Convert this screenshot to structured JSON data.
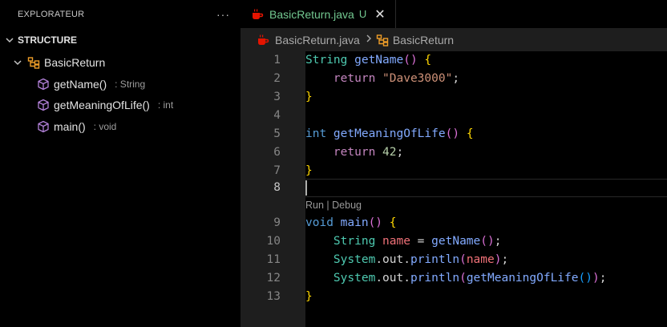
{
  "sidebar": {
    "title": "EXPLORATEUR",
    "more_label": "···",
    "section_label": "STRUCTURE",
    "class_name": "BasicReturn",
    "members": [
      {
        "name": "getName()",
        "detail": ": String",
        "icon": "method-cube-icon"
      },
      {
        "name": "getMeaningOfLife()",
        "detail": ": int",
        "icon": "method-cube-icon"
      },
      {
        "name": "main()",
        "detail": ": void",
        "icon": "method-cube-icon"
      }
    ]
  },
  "tab": {
    "file_name": "BasicReturn.java",
    "status": "U",
    "close_label": "✕",
    "icon": "java-file-icon"
  },
  "breadcrumbs": {
    "file": "BasicReturn.java",
    "symbol": "BasicReturn"
  },
  "codelens": {
    "run": "Run",
    "sep": " | ",
    "debug": "Debug"
  },
  "editor": {
    "line_numbers": [
      "1",
      "2",
      "3",
      "4",
      "5",
      "6",
      "7",
      "8",
      "9",
      "10",
      "11",
      "12",
      "13"
    ],
    "active_line": "8",
    "lines": [
      [
        [
          "String ",
          "t-type"
        ],
        [
          "getName",
          "t-fn2"
        ],
        [
          "()",
          "t-br2"
        ],
        [
          " ",
          "t-plain"
        ],
        [
          "{",
          "t-br"
        ]
      ],
      [
        [
          "    ",
          "t-plain"
        ],
        [
          "return ",
          "t-ctl"
        ],
        [
          "\"Dave3000\"",
          "t-str"
        ],
        [
          ";",
          "t-plain"
        ]
      ],
      [
        [
          "}",
          "t-br"
        ]
      ],
      [],
      [
        [
          "int ",
          "t-kw"
        ],
        [
          "getMeaningOfLife",
          "t-fn2"
        ],
        [
          "()",
          "t-br2"
        ],
        [
          " ",
          "t-plain"
        ],
        [
          "{",
          "t-br"
        ]
      ],
      [
        [
          "    ",
          "t-plain"
        ],
        [
          "return ",
          "t-ctl"
        ],
        [
          "42",
          "t-num"
        ],
        [
          ";",
          "t-plain"
        ]
      ],
      [
        [
          "}",
          "t-br"
        ]
      ],
      [],
      [
        [
          "void ",
          "t-kw"
        ],
        [
          "main",
          "t-fn2"
        ],
        [
          "()",
          "t-br2"
        ],
        [
          " ",
          "t-plain"
        ],
        [
          "{",
          "t-br"
        ]
      ],
      [
        [
          "    ",
          "t-plain"
        ],
        [
          "String ",
          "t-type"
        ],
        [
          "name",
          "t-var2"
        ],
        [
          " = ",
          "t-op"
        ],
        [
          "getName",
          "t-fn2"
        ],
        [
          "()",
          "t-br2"
        ],
        [
          ";",
          "t-plain"
        ]
      ],
      [
        [
          "    ",
          "t-plain"
        ],
        [
          "System",
          "t-type"
        ],
        [
          ".out.",
          "t-plain"
        ],
        [
          "println",
          "t-fn2"
        ],
        [
          "(",
          "t-br2"
        ],
        [
          "name",
          "t-var2"
        ],
        [
          ")",
          "t-br2"
        ],
        [
          ";",
          "t-plain"
        ]
      ],
      [
        [
          "    ",
          "t-plain"
        ],
        [
          "System",
          "t-type"
        ],
        [
          ".out.",
          "t-plain"
        ],
        [
          "println",
          "t-fn2"
        ],
        [
          "(",
          "t-br2"
        ],
        [
          "getMeaningOfLife",
          "t-fn2"
        ],
        [
          "()",
          "t-br3"
        ],
        [
          ")",
          "t-br2"
        ],
        [
          ";",
          "t-plain"
        ]
      ],
      [
        [
          "}",
          "t-br"
        ]
      ]
    ]
  },
  "colors": {
    "sidebar_bg": "#000000",
    "gutter_bg": "#1e1e1e",
    "code_bg": "#000000",
    "modified_green": "#73c991",
    "class_icon_orange": "#ee9d28",
    "method_icon_purple": "#b180d7",
    "java_icon_red": "#e51400"
  }
}
